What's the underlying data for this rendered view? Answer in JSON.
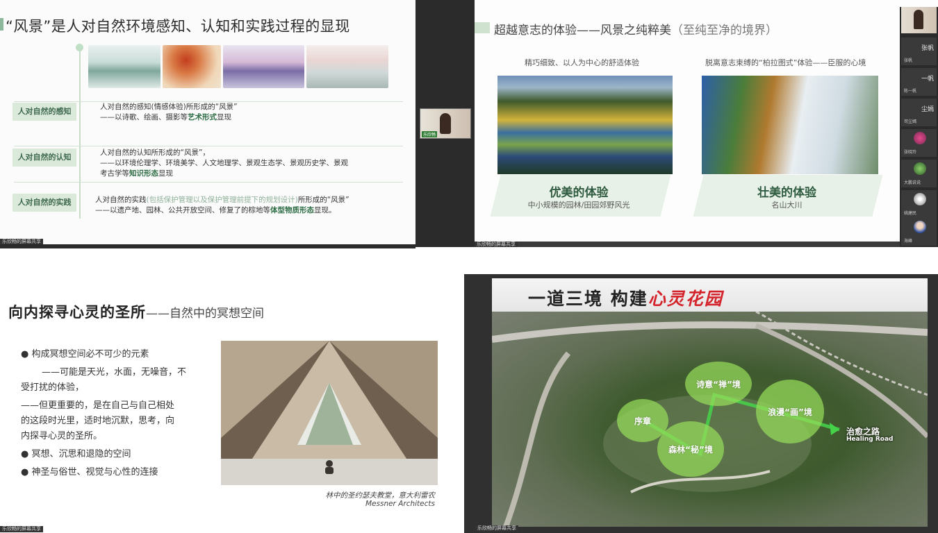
{
  "q1": {
    "title": "“风景”是人对自然环境感知、认知和实践过程的显现",
    "rows": [
      {
        "label": "人对自然的感知",
        "line1": "人对自然的感知(情感体验)所形成的“风景”",
        "line2_pre": "——以诗歌、绘画、摄影等",
        "line2_bold": "艺术形式",
        "line2_post": "显现"
      },
      {
        "label": "人对自然的认知",
        "line1": "人对自然的认知所形成的“风景”，",
        "line2": "——以环境伦理学、环境美学、人文地理学、景观生态学、景观历史学、景观",
        "line3_pre": "考古学等",
        "line3_bold": "知识形态",
        "line3_post": "显现"
      },
      {
        "label": "人对自然的实践",
        "line1_pre": "人对自然的实践",
        "line1_lite": "(包括保护管理以及保护管理前提下的规划设计)",
        "line1_post": "所形成的“风景”",
        "line2_pre": "——以遗产地、园林、公共开放空间、修复了的棕地等",
        "line2_bold": "体型物质形态",
        "line2_post": "显现。"
      }
    ],
    "share_label": "乐欣畅的屏幕共享"
  },
  "q2": {
    "title": "超越意志的体验——风景之纯粹美",
    "title_sub": "（至纯至净的境界）",
    "left_caption": "精巧细致、以人为中心的舒适体验",
    "right_caption": "脱离意志束缚的“柏拉图式”体验——臣服的心境",
    "left_big": "优美的体验",
    "left_small": "中小规模的园林/田园郊野风光",
    "right_big": "壮美的体验",
    "right_small": "名山大川",
    "share_label": "乐欣畅的屏幕共享",
    "participants": [
      {
        "name": "张帆",
        "sub": "张帆"
      },
      {
        "name": "一帆",
        "sub": "陈一帆"
      },
      {
        "name": "尘嫣",
        "sub": "司尘嫣"
      },
      {
        "name": "",
        "sub": "张晓玲"
      },
      {
        "name": "",
        "sub": "大鹏说说"
      },
      {
        "name": "",
        "sub": "姚建民"
      },
      {
        "name": "",
        "sub": "海峰"
      }
    ]
  },
  "q3": {
    "title": "向内探寻心灵的圣所",
    "title_sub": "——自然中的冥想空间",
    "bullet1": "● 构成冥想空间必不可少的元素",
    "text1a": "——可能是天光，水面，无噪音，不",
    "text1b": "受打扰的体验，",
    "text2a": "——但更重要的，是在自己与自己相处",
    "text2b": "的这段时光里，适时地沉默，思考，向",
    "text2c": "内探寻心灵的圣所。",
    "bullet2": "● 冥想、沉思和退隐的空间",
    "bullet3": "● 神圣与俗世、视觉与心性的连接",
    "caption1": "林中的圣约瑟夫教堂，意大利雷农",
    "caption2": "Messner Architects",
    "share_label": "乐欣畅的屏幕共享"
  },
  "q4": {
    "title": "一道三境  构建",
    "title_red": "心灵花园",
    "bubbles": [
      "诗意“禅”境",
      "序章",
      "浪漫“画”境",
      "森林“秘”境"
    ],
    "heal_cn": "治愈之路",
    "heal_en": "Healing Road",
    "share_label": "乐欣畅的屏幕共享"
  },
  "thumb_name": "乐欣畅",
  "colors": {
    "accent_green": "#8db79a",
    "label_bg": "#dbe9da",
    "title_red": "#d4232b",
    "bubble_green": "#96dc5a"
  }
}
